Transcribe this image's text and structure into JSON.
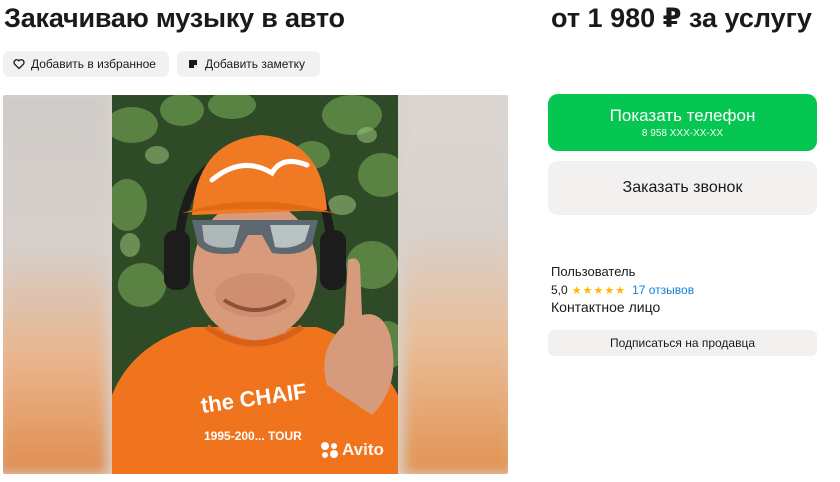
{
  "listing": {
    "title": "Закачиваю музыку в авто",
    "price": "от 1 980 ₽ за услугу"
  },
  "actions": {
    "favorite_label": "Добавить в избранное",
    "note_label": "Добавить заметку"
  },
  "gallery": {
    "watermark": "Avito",
    "shirt_text": "the CHAIF",
    "shirt_subtext": "1995-200... TOUR"
  },
  "contact_panel": {
    "show_phone_label": "Показать телефон",
    "phone_masked": "8 958 XXX-XX-XX",
    "request_call_label": "Заказать звонок",
    "accent_color": "#05c650"
  },
  "seller": {
    "type": "Пользователь",
    "rating": "5,0",
    "stars": 5,
    "reviews": "17 отзывов",
    "role": "Контактное лицо",
    "subscribe_label": "Подписаться на продавца"
  }
}
